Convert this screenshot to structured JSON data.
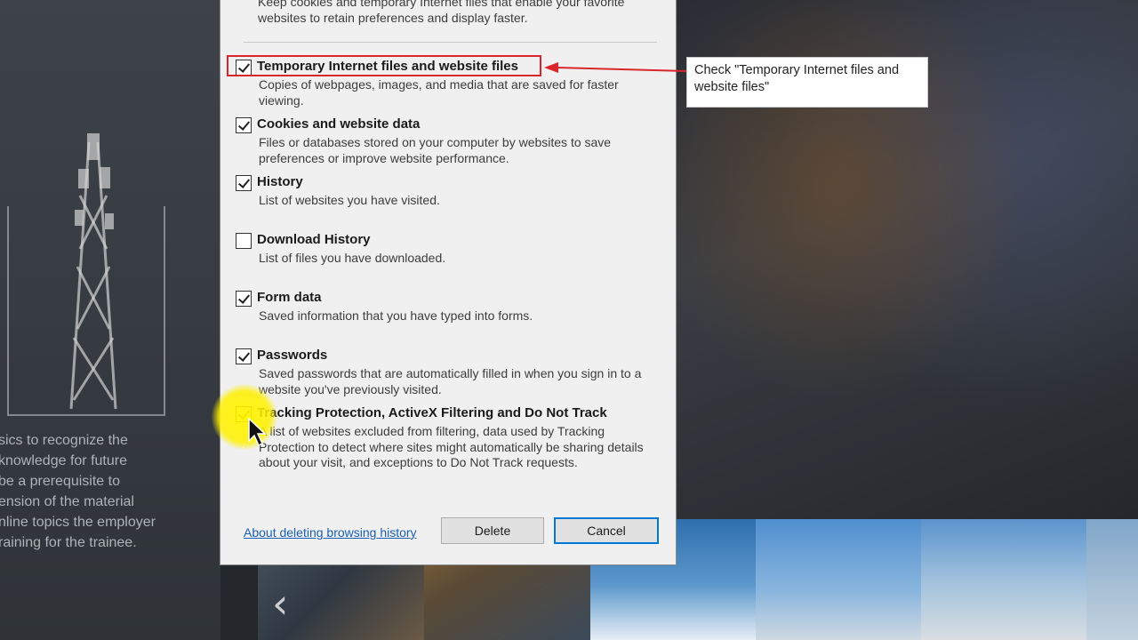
{
  "background": {
    "text_lines": [
      "sics to recognize the",
      "knowledge for future",
      "be a prerequisite to",
      "ension of the material",
      "nline topics the employer",
      "raining for the trainee."
    ]
  },
  "dialog": {
    "top_description": "Keep cookies and temporary Internet files that enable your favorite websites to retain preferences and display faster.",
    "options": [
      {
        "label": "Temporary Internet files and website files",
        "description": "Copies of webpages, images, and media that are saved for faster viewing.",
        "checked": true
      },
      {
        "label": "Cookies and website data",
        "description": "Files or databases stored on your computer by websites to save preferences or improve website performance.",
        "checked": true
      },
      {
        "label": "History",
        "description": "List of websites you have visited.",
        "checked": true
      },
      {
        "label": "Download History",
        "description": "List of files you have downloaded.",
        "checked": false
      },
      {
        "label": "Form data",
        "description": "Saved information that you have typed into forms.",
        "checked": true
      },
      {
        "label": "Passwords",
        "description": "Saved passwords that are automatically filled in when you sign in to a website you've previously visited.",
        "checked": true
      },
      {
        "label": "Tracking Protection, ActiveX Filtering and Do Not Track",
        "description": "A list of websites excluded from filtering, data used by Tracking Protection to detect where sites might automatically be sharing details about your visit, and exceptions to Do Not Track requests.",
        "checked": true
      }
    ],
    "about_link": "About deleting browsing history",
    "delete_label": "Delete",
    "cancel_label": "Cancel"
  },
  "annotation": {
    "callout_text": "Check \"Temporary Internet files and website files\"",
    "highlight_color": "#d9262a"
  },
  "icons": {
    "thumbnail_prev": "chevron-left-icon",
    "cursor": "mouse-pointer-icon"
  }
}
